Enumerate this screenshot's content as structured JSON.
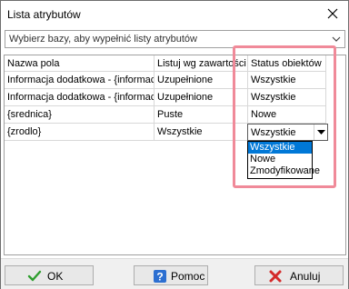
{
  "window": {
    "title": "Lista atrybutów"
  },
  "database_select": {
    "placeholder": "Wybierz bazy, aby wypełnić listy atrybutów"
  },
  "grid": {
    "headers": [
      "Nazwa pola",
      "Listuj wg zawartości",
      "Status obiektów"
    ],
    "rows": [
      [
        "Informacja dodatkowa - {informacja",
        "Uzupełnione",
        "Wszystkie"
      ],
      [
        "Informacja dodatkowa - {informacja",
        "Uzupełnione",
        "Wszystkie"
      ],
      [
        "{srednica}",
        "Puste",
        "Nowe"
      ],
      [
        "{zrodlo}",
        "Wszystkie",
        "Wszystkie"
      ]
    ]
  },
  "status_dropdown": {
    "selected": "Wszystkie",
    "options": [
      "Wszystkie",
      "Nowe",
      "Zmodyfikowane"
    ]
  },
  "footer": {
    "ok_label": "OK",
    "help_label": "Pomoc",
    "cancel_label": "Anuluj"
  },
  "colors": {
    "highlight": "#f08a99",
    "selection": "#0078d7"
  },
  "icons": {
    "close": "close-icon",
    "ok": "checkmark-icon",
    "help": "help-icon",
    "cancel": "cancel-icon"
  }
}
